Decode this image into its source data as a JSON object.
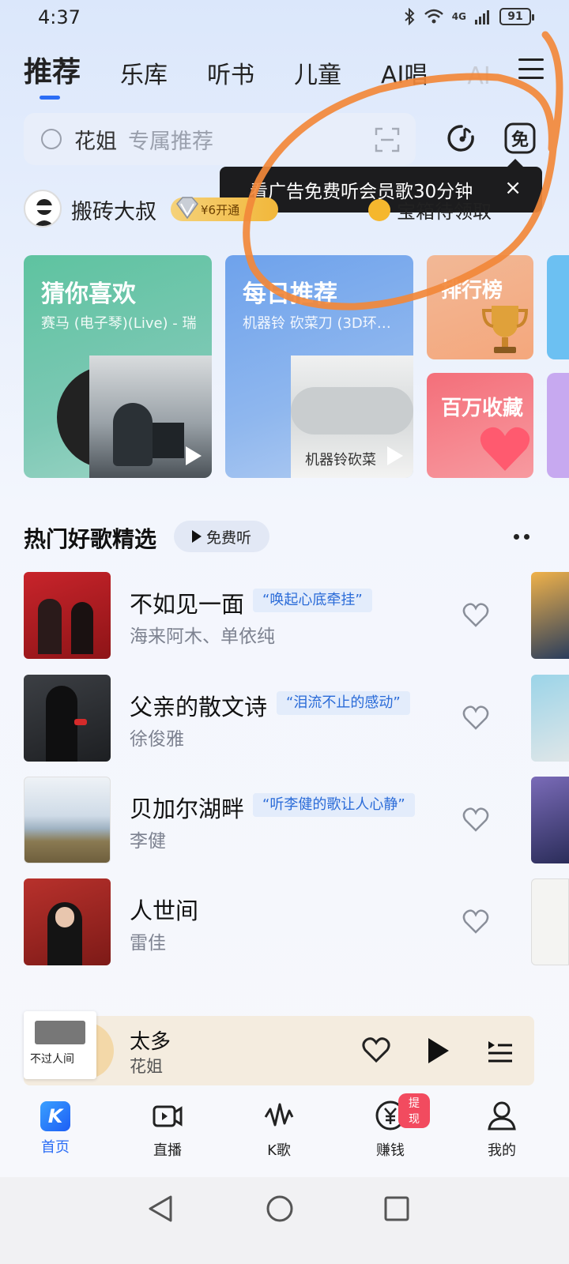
{
  "status_bar": {
    "time": "4:37",
    "network": "4G",
    "battery": "91"
  },
  "tabs": [
    {
      "label": "推荐",
      "active": true
    },
    {
      "label": "乐库"
    },
    {
      "label": "听书"
    },
    {
      "label": "儿童"
    },
    {
      "label": "AI唱"
    },
    {
      "label": "AI"
    }
  ],
  "search": {
    "keyword": "花姐",
    "hint": "专属推荐"
  },
  "tooltip": {
    "text": "看广告免费听会员歌30分钟",
    "close": "×"
  },
  "profile": {
    "name": "搬砖大叔",
    "vip_text": "¥6开通",
    "treasure": "宝箱待领取"
  },
  "cards": {
    "guess": {
      "title": "猜你喜欢",
      "subtitle": "赛马 (电子琴)(Live) - 瑞"
    },
    "daily": {
      "title": "每日推荐",
      "subtitle": "机器铃 砍菜刀 (3D环…",
      "cover_text": "机器铃砍菜"
    },
    "rank": {
      "title": "排行榜"
    },
    "collect": {
      "title": "百万收藏"
    }
  },
  "section": {
    "title": "热门好歌精选",
    "free_label": "免费听"
  },
  "songs": [
    {
      "title": "不如见一面",
      "tag": "“唤起心底牵挂”",
      "artist": "海来阿木、单依纯"
    },
    {
      "title": "父亲的散文诗",
      "tag": "“泪流不止的感动”",
      "artist": "徐俊雅"
    },
    {
      "title": "贝加尔湖畔",
      "tag": "“听李健的歌让人心静”",
      "artist": "李健"
    },
    {
      "title": "人世间",
      "tag": "",
      "artist": "雷佳"
    }
  ],
  "now_playing": {
    "title": "太多",
    "artist": "花姐",
    "cover_text": "不过人间"
  },
  "bottom_nav": [
    {
      "label": "首页",
      "active": true
    },
    {
      "label": "直播"
    },
    {
      "label": "K歌"
    },
    {
      "label": "赚钱",
      "badge": "提现"
    },
    {
      "label": "我的"
    }
  ],
  "colors": {
    "accent": "#2b6df5",
    "annotation": "#f2883a"
  }
}
